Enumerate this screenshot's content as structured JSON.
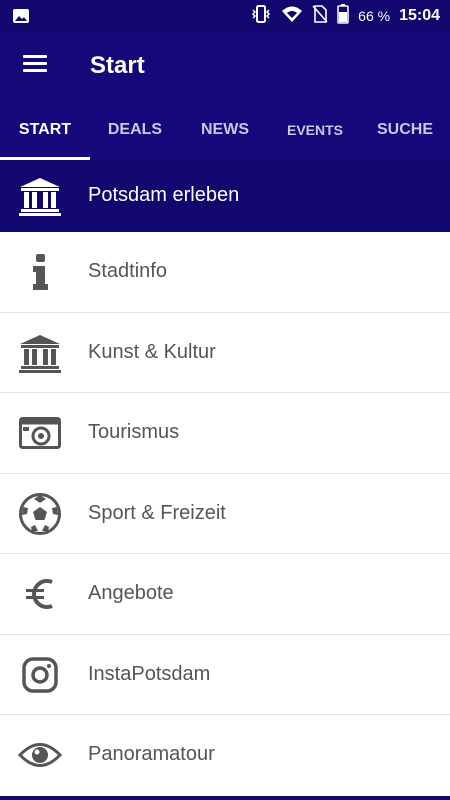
{
  "status_bar": {
    "battery_percent": "66 %",
    "time": "15:04",
    "icons": [
      "image-icon",
      "vibrate-icon",
      "wifi-icon",
      "no-sim-icon",
      "battery-icon"
    ]
  },
  "app_bar": {
    "title": "Start",
    "menu_icon": "hamburger-menu-icon"
  },
  "tabs": [
    {
      "label": "START",
      "active": true
    },
    {
      "label": "DEALS",
      "active": false
    },
    {
      "label": "NEWS",
      "active": false
    },
    {
      "label": "EVENTS",
      "active": false
    },
    {
      "label": "SUCHE",
      "active": false
    }
  ],
  "featured": {
    "label": "Potsdam erleben",
    "icon": "museum-icon"
  },
  "menu_items": [
    {
      "label": "Stadtinfo",
      "icon": "info-icon"
    },
    {
      "label": "Kunst & Kultur",
      "icon": "museum-icon"
    },
    {
      "label": "Tourismus",
      "icon": "camera-icon"
    },
    {
      "label": "Sport & Freizeit",
      "icon": "soccer-ball-icon"
    },
    {
      "label": "Angebote",
      "icon": "euro-icon"
    },
    {
      "label": "InstaPotsdam",
      "icon": "instagram-icon"
    },
    {
      "label": "Panoramatour",
      "icon": "eye-icon"
    }
  ],
  "colors": {
    "primary": "#14087a",
    "primary_dark": "#12066f",
    "icon_gray": "#555555"
  }
}
